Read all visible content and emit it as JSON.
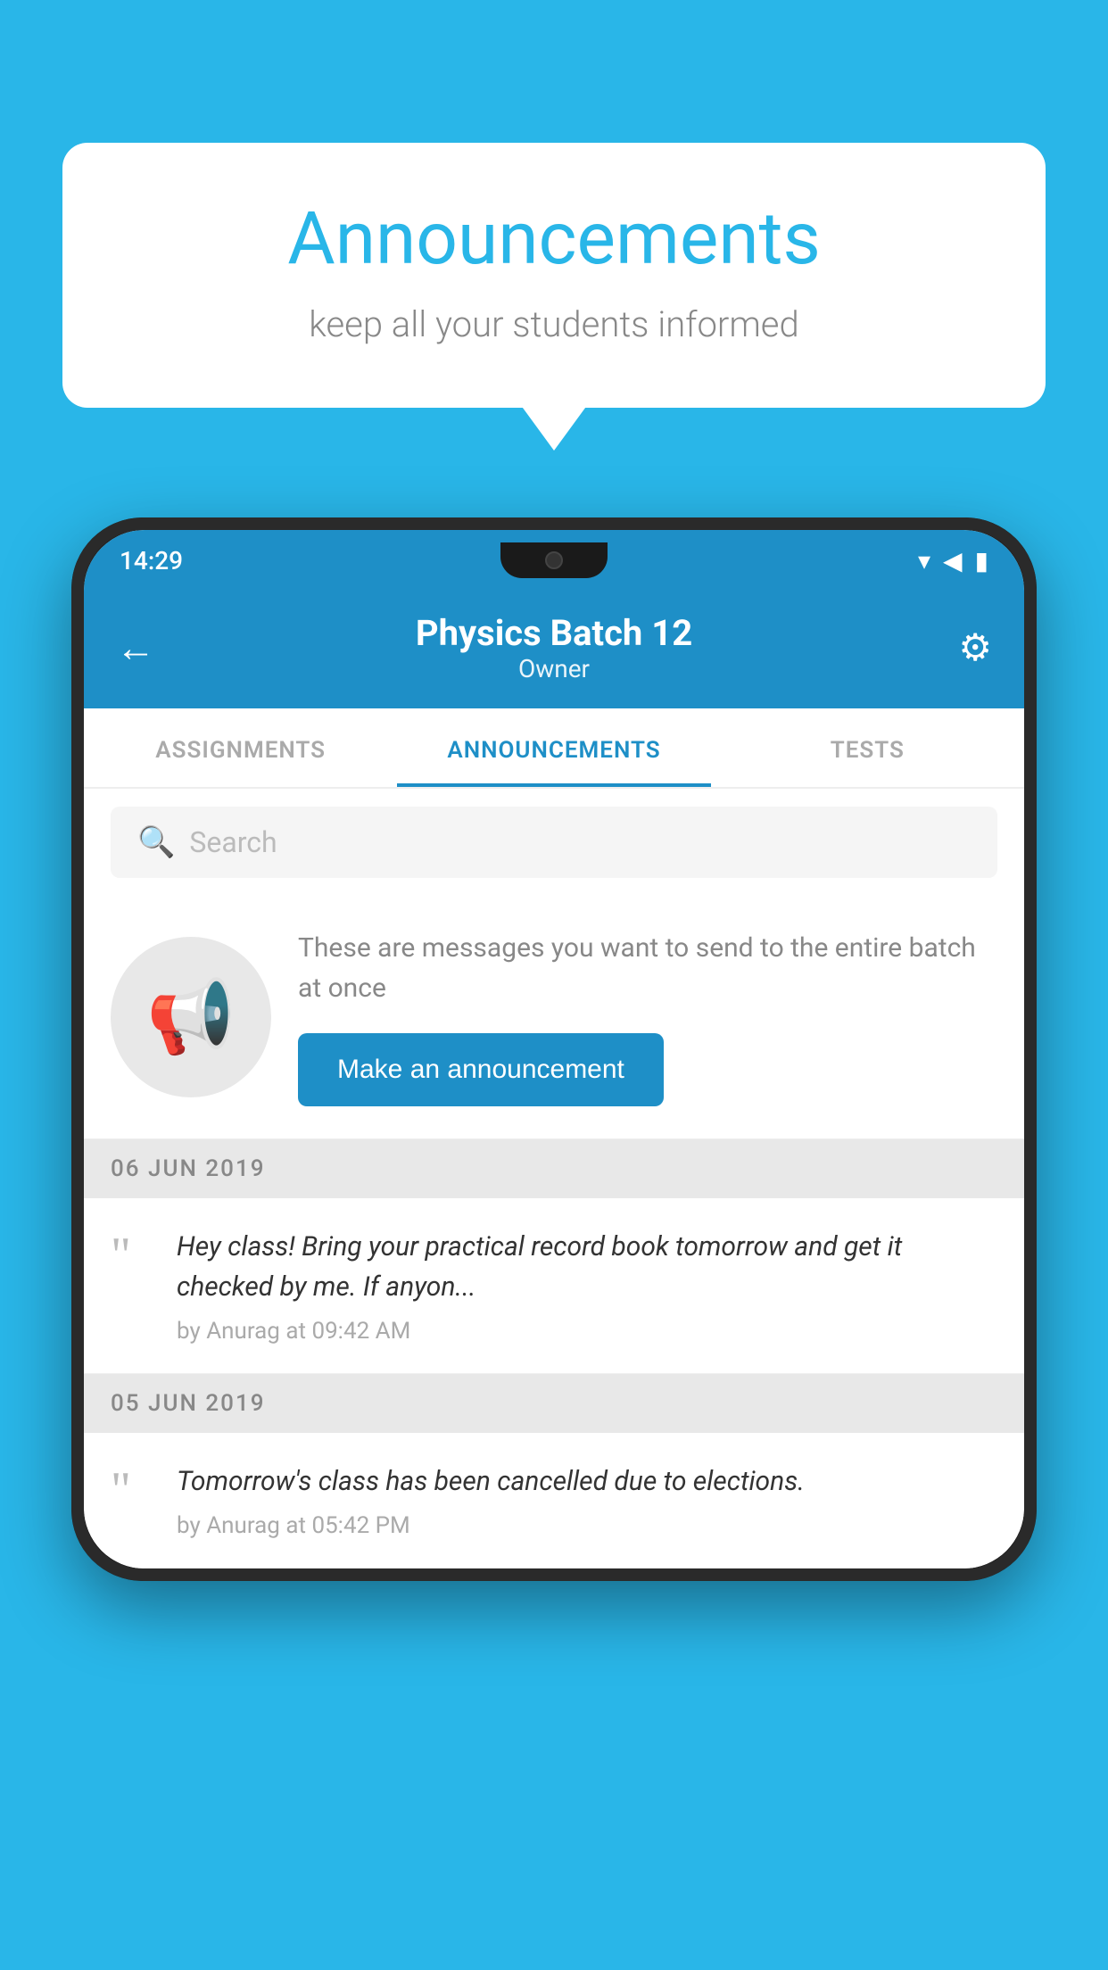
{
  "background_color": "#29b6e8",
  "speech_bubble": {
    "title": "Announcements",
    "subtitle": "keep all your students informed"
  },
  "phone": {
    "status_bar": {
      "time": "14:29",
      "wifi": "▾",
      "signal": "▲",
      "battery": "▮"
    },
    "header": {
      "back_label": "←",
      "title": "Physics Batch 12",
      "subtitle": "Owner",
      "settings_label": "⚙"
    },
    "tabs": [
      {
        "label": "ASSIGNMENTS",
        "active": false
      },
      {
        "label": "ANNOUNCEMENTS",
        "active": true
      },
      {
        "label": "TESTS",
        "active": false
      }
    ],
    "search": {
      "placeholder": "Search"
    },
    "announcement_intro": {
      "description": "These are messages you want to send to the entire batch at once",
      "button_label": "Make an announcement"
    },
    "announcements": [
      {
        "date": "06  JUN  2019",
        "text": "Hey class! Bring your practical record book tomorrow and get it checked by me. If anyon...",
        "meta": "by Anurag at 09:42 AM"
      },
      {
        "date": "05  JUN  2019",
        "text": "Tomorrow's class has been cancelled due to elections.",
        "meta": "by Anurag at 05:42 PM"
      }
    ]
  }
}
